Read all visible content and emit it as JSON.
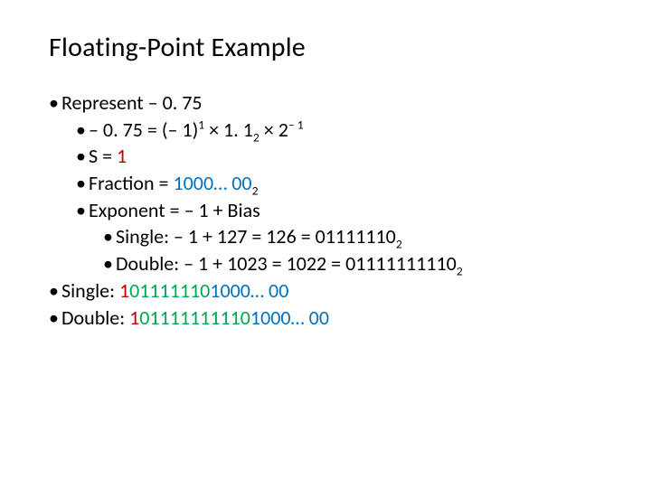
{
  "title": "Floating-Point Example",
  "bullets": {
    "represent": "Represent – 0. 75",
    "eq_l": "– 0. 75 = (– 1)",
    "eq_sup1": "1",
    "eq_mid1": " × 1. 1",
    "eq_sub2": "2",
    "eq_mid2": " × 2",
    "eq_supN1": "– 1",
    "s_label": "S = ",
    "s_val": "1",
    "frac_label": "Fraction = ",
    "frac_val": "1000… 00",
    "frac_sub": "2",
    "exp": "Exponent = – 1 + Bias",
    "single_label": "Single: – 1 + 127 = 126 = 01111110",
    "single_sub": "2",
    "double_label": "Double: – 1 + 1023 = 1022 = 01111111110",
    "double_sub": "2",
    "ans_single_lbl": "Single: ",
    "ans_s_sign": "1",
    "ans_s_exp": "01111110",
    "ans_s_frac": "1000… 00",
    "ans_double_lbl": "Double: ",
    "ans_d_sign": "1",
    "ans_d_exp": "01111111110",
    "ans_d_frac": "1000… 00"
  }
}
